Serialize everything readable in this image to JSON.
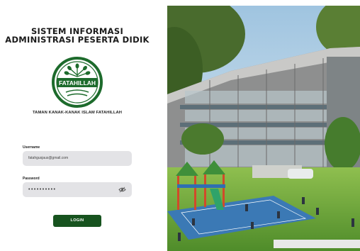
{
  "app": {
    "title_line1": "SISTEM INFORMASI",
    "title_line2": "ADMINISTRASI PESERTA DIDIK"
  },
  "logo": {
    "text": "FATAHILLAH"
  },
  "school": {
    "name": "TAMAN KANAK-KANAK ISLAM FATAHILLAH"
  },
  "form": {
    "username_label": "Username",
    "username_value": "fatahgusjaus@gmail.com",
    "password_label": "Password",
    "password_value": "••••••••••",
    "login_label": "LOGIN"
  },
  "colors": {
    "brand_green": "#17531f",
    "field_bg": "#e3e3e6"
  },
  "icons": {
    "password_toggle": "eye-icon"
  }
}
